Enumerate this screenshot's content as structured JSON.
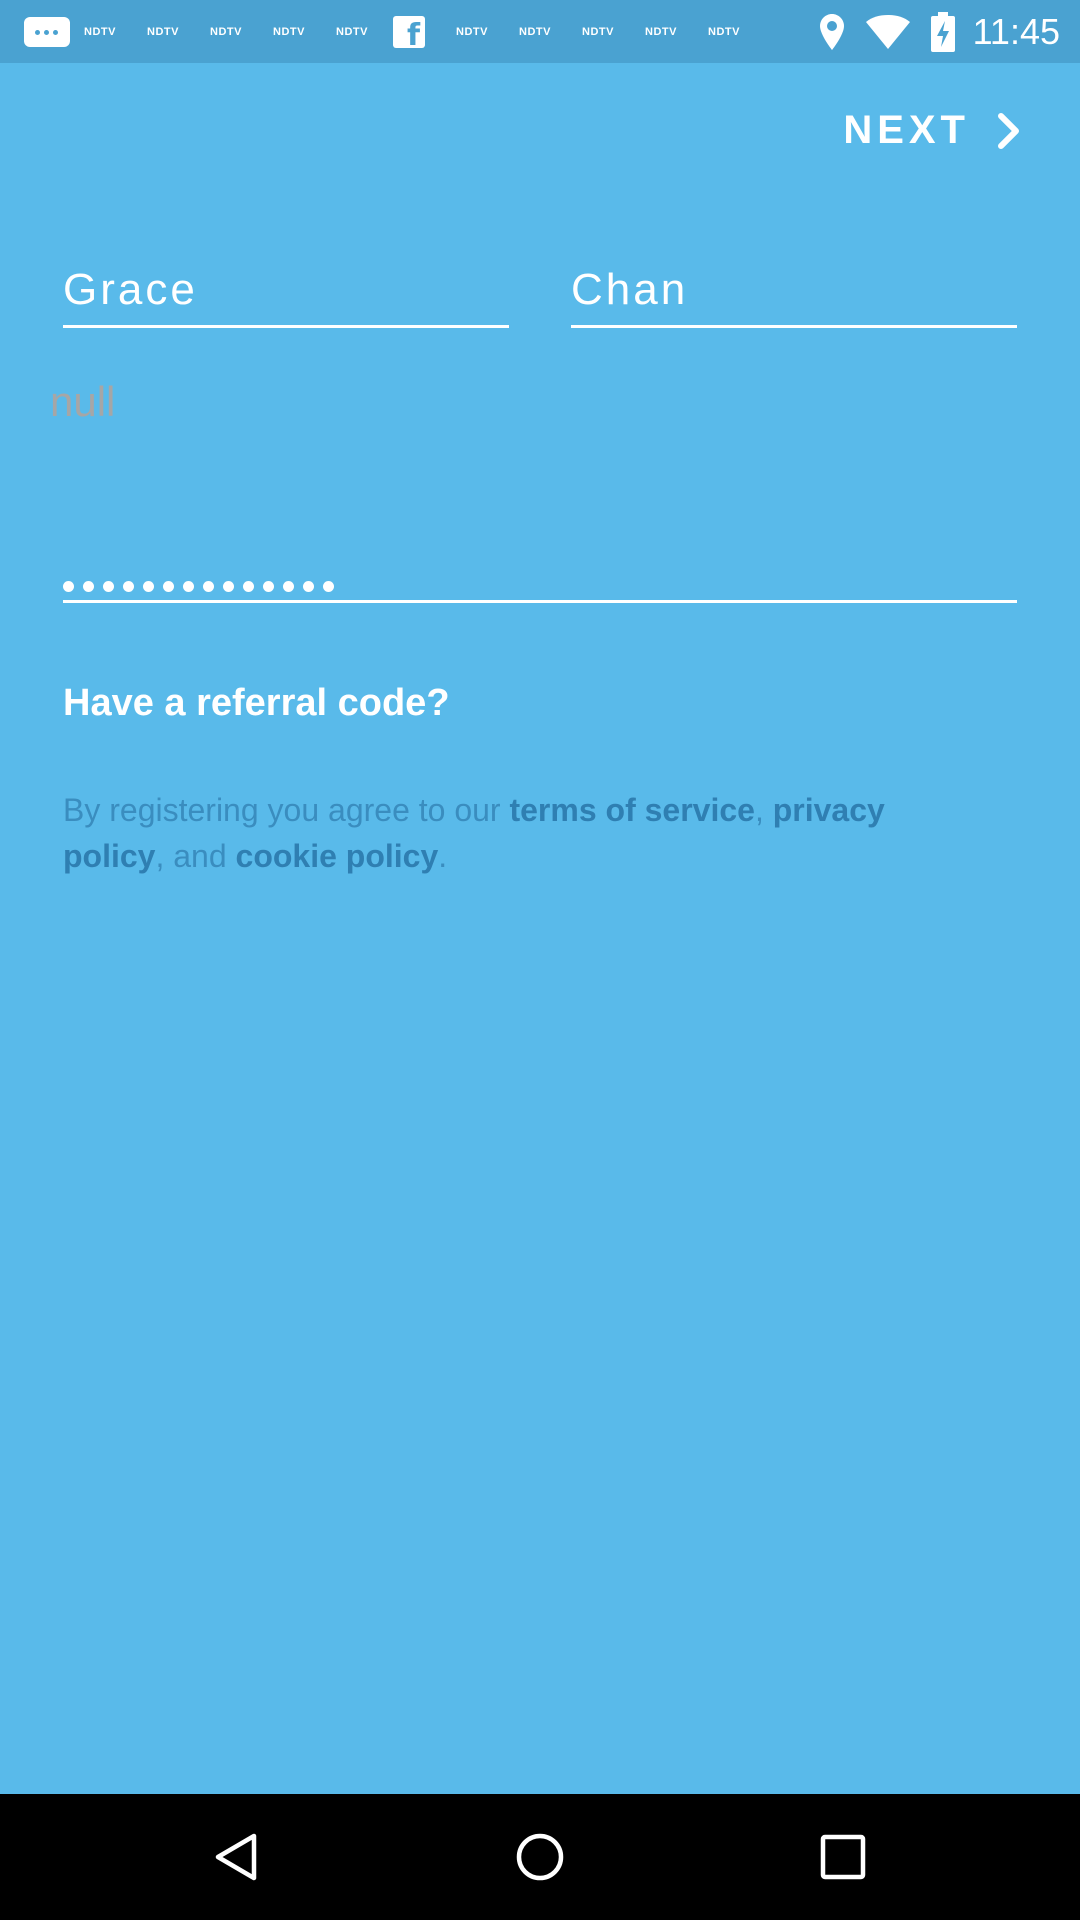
{
  "status_bar": {
    "time": "11:45",
    "notifications": [
      "NDTV",
      "NDTV",
      "NDTV",
      "NDTV",
      "NDTV",
      "NDTV",
      "NDTV",
      "NDTV",
      "NDTV",
      "NDTV"
    ],
    "facebook_glyph": "f",
    "icons": [
      "messages-icon",
      "facebook-icon",
      "location-icon",
      "wifi-icon",
      "battery-icon"
    ]
  },
  "header": {
    "next_label": "NEXT",
    "next_icon": "chevron-right-icon"
  },
  "form": {
    "first_name": "Grace",
    "last_name": "Chan",
    "email_value": "null",
    "password_dot_count": 14
  },
  "referral": {
    "label": "Have a referral code?"
  },
  "terms": {
    "prefix": "By registering you agree to our ",
    "terms_link": "terms of service",
    "sep1": ", ",
    "privacy_link": "privacy policy",
    "sep2": ", and ",
    "cookie_link": "cookie policy",
    "suffix": "."
  },
  "nav": {
    "icons": [
      "back-icon",
      "home-icon",
      "recents-icon"
    ]
  },
  "colors": {
    "background": "#59baea",
    "status_bar": "#4aa2d1",
    "text": "#ffffff",
    "muted_link": "#2f7fb2",
    "null_text": "#a6a6a6"
  }
}
